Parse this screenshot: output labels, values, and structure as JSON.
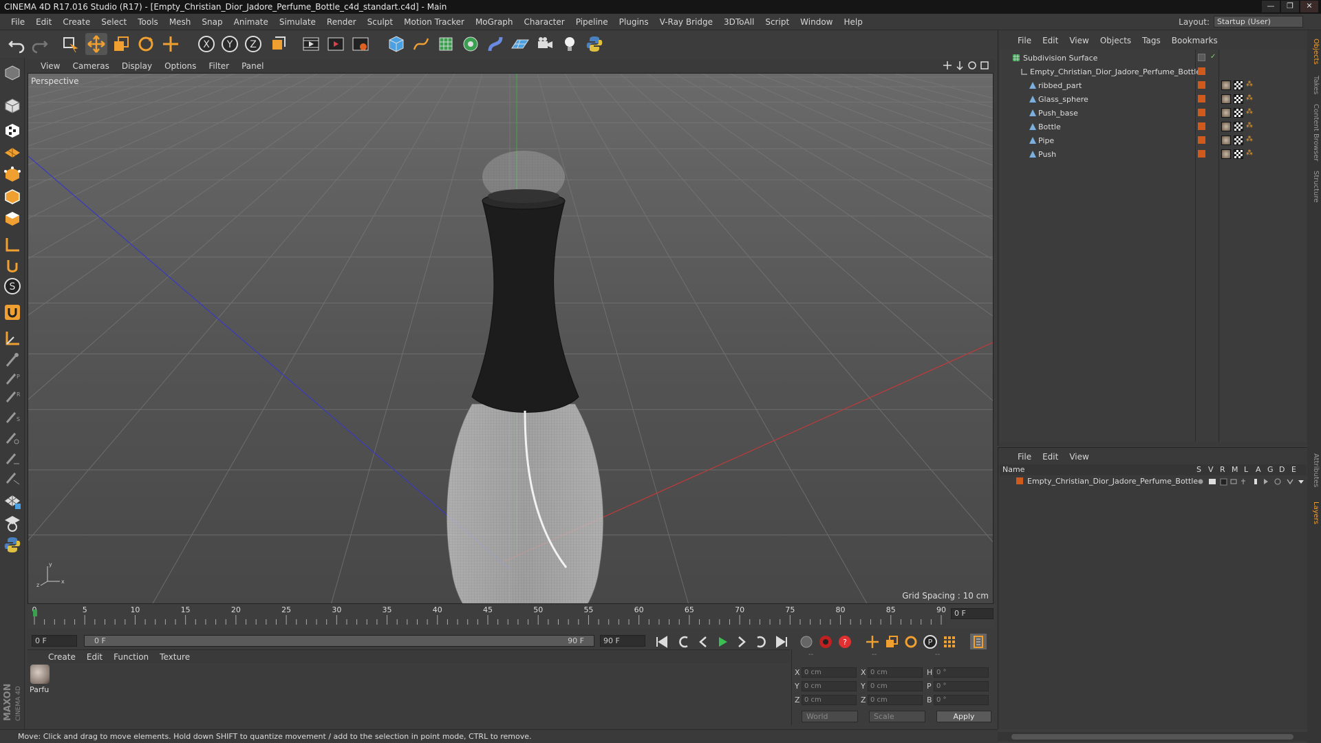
{
  "window": {
    "title": "CINEMA 4D R17.016 Studio (R17) - [Empty_Christian_Dior_Jadore_Perfume_Bottle_c4d_standart.c4d] - Main",
    "controls": [
      "—",
      "❐",
      "✕"
    ]
  },
  "menubar": {
    "items": [
      "File",
      "Edit",
      "Create",
      "Select",
      "Tools",
      "Mesh",
      "Snap",
      "Animate",
      "Simulate",
      "Render",
      "Sculpt",
      "Motion Tracker",
      "MoGraph",
      "Character",
      "Pipeline",
      "Plugins",
      "V-Ray Bridge",
      "3DToAll",
      "Script",
      "Window",
      "Help"
    ],
    "layout_label": "Layout:",
    "layout_value": "Startup (User)"
  },
  "viewport": {
    "menu": [
      "View",
      "Cameras",
      "Display",
      "Options",
      "Filter",
      "Panel"
    ],
    "label": "Perspective",
    "grid_spacing": "Grid Spacing : 10 cm"
  },
  "timeline": {
    "ticks": [
      "0",
      "5",
      "10",
      "15",
      "20",
      "25",
      "30",
      "35",
      "40",
      "45",
      "50",
      "55",
      "60",
      "65",
      "70",
      "75",
      "80",
      "85",
      "90"
    ],
    "current_frame": "0 F",
    "start_field": "0 F",
    "range_start": "0 F",
    "range_end": "90 F",
    "end_field": "90 F"
  },
  "material_manager": {
    "menu": [
      "Create",
      "Edit",
      "Function",
      "Texture"
    ],
    "material_name": "Parfu"
  },
  "coordinates": {
    "headers": [
      "--",
      "--",
      "--"
    ],
    "rows": [
      {
        "l1": "X",
        "v1": "0 cm",
        "l2": "X",
        "v2": "0 cm",
        "l3": "H",
        "v3": "0 °"
      },
      {
        "l1": "Y",
        "v1": "0 cm",
        "l2": "Y",
        "v2": "0 cm",
        "l3": "P",
        "v3": "0 °"
      },
      {
        "l1": "Z",
        "v1": "0 cm",
        "l2": "Z",
        "v2": "0 cm",
        "l3": "B",
        "v3": "0 °"
      }
    ],
    "mode": "World",
    "size_mode": "Scale",
    "apply_label": "Apply"
  },
  "status": {
    "text": "Move: Click and drag to move elements. Hold down SHIFT to quantize movement / add to the selection in point mode, CTRL to remove."
  },
  "object_manager": {
    "menu": [
      "File",
      "Edit",
      "View",
      "Objects",
      "Tags",
      "Bookmarks"
    ],
    "objects": [
      {
        "name": "Subdivision Surface",
        "indent": 0,
        "type": "subdivision"
      },
      {
        "name": "Empty_Christian_Dior_Jadore_Perfume_Bottle",
        "indent": 1,
        "type": "null"
      },
      {
        "name": "ribbed_part",
        "indent": 2,
        "type": "polygon"
      },
      {
        "name": "Glass_sphere",
        "indent": 2,
        "type": "polygon"
      },
      {
        "name": "Push_base",
        "indent": 2,
        "type": "polygon"
      },
      {
        "name": "Bottle",
        "indent": 2,
        "type": "polygon"
      },
      {
        "name": "Pipe",
        "indent": 2,
        "type": "polygon"
      },
      {
        "name": "Push",
        "indent": 2,
        "type": "polygon"
      }
    ]
  },
  "layer_manager": {
    "menu": [
      "File",
      "Edit",
      "View"
    ],
    "columns": [
      "Name",
      "S",
      "V",
      "R",
      "M",
      "L",
      "A",
      "G",
      "D",
      "E"
    ],
    "layers": [
      {
        "name": "Empty_Christian_Dior_Jadore_Perfume_Bottle",
        "color": "#d05a1c"
      }
    ]
  },
  "right_tabs": [
    "Objects",
    "Takes",
    "Content Browser",
    "Structure",
    "Attributes",
    "Layers"
  ],
  "colors": {
    "accent_orange": "#f0a030",
    "layer_orange": "#d05a1c",
    "axis_x": "#c03030",
    "axis_y": "#30c030",
    "axis_z": "#3030c0"
  }
}
